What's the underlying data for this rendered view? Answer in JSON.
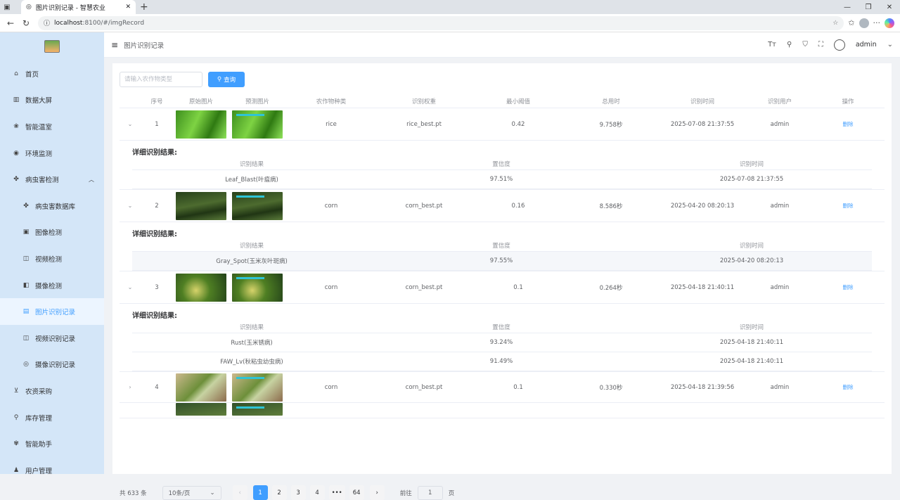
{
  "browser": {
    "tab_title": "图片识别记录 - 智慧农业",
    "url_host": "localhost",
    "url_rest": ":8100/#/imgRecord"
  },
  "sidebar": {
    "items": [
      {
        "label": "首页",
        "icon": "home-icon"
      },
      {
        "label": "数据大屏",
        "icon": "chart-icon"
      },
      {
        "label": "智能温室",
        "icon": "greenhouse-icon"
      },
      {
        "label": "环境监测",
        "icon": "monitor-icon"
      },
      {
        "label": "病虫害检测",
        "icon": "bug-icon",
        "expanded": true
      },
      {
        "label": "病虫害数据库",
        "icon": "database-icon",
        "sub": true
      },
      {
        "label": "图像检测",
        "icon": "image-icon",
        "sub": true
      },
      {
        "label": "视频检测",
        "icon": "video-icon",
        "sub": true
      },
      {
        "label": "摄像检测",
        "icon": "camera-icon",
        "sub": true
      },
      {
        "label": "图片识别记录",
        "icon": "image-record-icon",
        "sub": true,
        "active": true
      },
      {
        "label": "视频识别记录",
        "icon": "video-record-icon",
        "sub": true
      },
      {
        "label": "摄像识别记录",
        "icon": "camera-record-icon",
        "sub": true
      },
      {
        "label": "农资采购",
        "icon": "cart-icon"
      },
      {
        "label": "库存管理",
        "icon": "inventory-icon"
      },
      {
        "label": "智能助手",
        "icon": "assistant-icon"
      },
      {
        "label": "用户管理",
        "icon": "users-icon"
      }
    ]
  },
  "header": {
    "breadcrumb": "图片识别记录",
    "user": "admin"
  },
  "search": {
    "placeholder": "请输入农作物类型",
    "button": "查询"
  },
  "table": {
    "columns": [
      "序号",
      "原始图片",
      "预测图片",
      "农作物种类",
      "识别权重",
      "最小阈值",
      "总用时",
      "识别时间",
      "识别用户",
      "操作"
    ],
    "detail_title": "详细识别结果:",
    "detail_columns": [
      "识别结果",
      "置信度",
      "识别时间"
    ],
    "rows": [
      {
        "index": "1",
        "crop": "rice",
        "weight": "rice_best.pt",
        "threshold": "0.42",
        "time_used": "9.758秒",
        "time": "2025-07-08 21:37:55",
        "user": "admin",
        "op": "删除",
        "details": [
          {
            "result": "Leaf_Blast(叶瘟病)",
            "conf": "97.51%",
            "time": "2025-07-08 21:37:55"
          }
        ]
      },
      {
        "index": "2",
        "crop": "corn",
        "weight": "corn_best.pt",
        "threshold": "0.16",
        "time_used": "8.586秒",
        "time": "2025-04-20 08:20:13",
        "user": "admin",
        "op": "删除",
        "details": [
          {
            "result": "Gray_Spot(玉米灰叶斑病)",
            "conf": "97.55%",
            "time": "2025-04-20 08:20:13"
          }
        ]
      },
      {
        "index": "3",
        "crop": "corn",
        "weight": "corn_best.pt",
        "threshold": "0.1",
        "time_used": "0.264秒",
        "time": "2025-04-18 21:40:11",
        "user": "admin",
        "op": "删除",
        "details": [
          {
            "result": "Rust(玉米锈病)",
            "conf": "93.24%",
            "time": "2025-04-18 21:40:11"
          },
          {
            "result": "FAW_Lv(秋粘虫幼虫病)",
            "conf": "91.49%",
            "time": "2025-04-18 21:40:11"
          }
        ]
      },
      {
        "index": "4",
        "crop": "corn",
        "weight": "corn_best.pt",
        "threshold": "0.1",
        "time_used": "0.330秒",
        "time": "2025-04-18 21:39:56",
        "user": "admin",
        "op": "删除"
      }
    ]
  },
  "pagination": {
    "total": "共 633 条",
    "page_size": "10条/页",
    "pages": [
      "1",
      "2",
      "3",
      "4",
      "•••",
      "64"
    ],
    "goto_label": "前往",
    "goto_value": "1",
    "page_suffix": "页"
  }
}
